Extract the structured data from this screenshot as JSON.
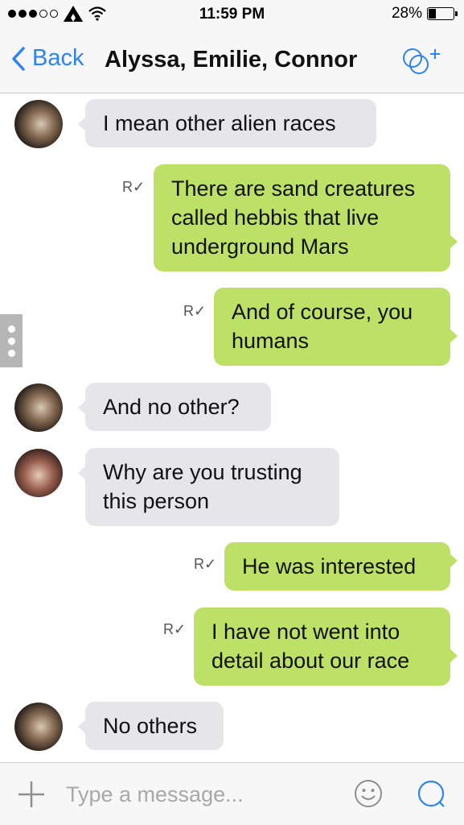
{
  "status": {
    "time": "11:59 PM",
    "battery": "28%",
    "battery_level": 0.28
  },
  "nav": {
    "back_label": "Back",
    "title": "Alyssa, Emilie, Connor",
    "accent_color": "#2b83f6"
  },
  "messages": [
    {
      "direction": "in",
      "text": "I mean other alien races"
    },
    {
      "direction": "out",
      "text": [
        "There are sand creatures",
        "called hebbis that live",
        "underground Mars"
      ],
      "receipt": "R"
    },
    {
      "direction": "out",
      "text": [
        "And of course, you",
        "humans"
      ],
      "receipt": "R"
    },
    {
      "direction": "in",
      "text": "And no other?"
    },
    {
      "direction": "in",
      "text": [
        "Why are you trusting",
        "this person"
      ]
    },
    {
      "direction": "out",
      "text": "He was interested",
      "receipt": "R"
    },
    {
      "direction": "out",
      "text": [
        "I have not went into",
        "detail about our race"
      ],
      "receipt": "R"
    },
    {
      "direction": "in",
      "text": "No others"
    }
  ],
  "m": {
    "m1": "I mean other alien races",
    "m2a": "There are sand creatures",
    "m2b": "called hebbis that live",
    "m2c": "underground Mars",
    "m3a": "And of course, you",
    "m3b": "humans",
    "m4": "And no other?",
    "m5a": "Why are you trusting",
    "m5b": "this person",
    "m6": "He was interested",
    "m7a": "I have not went into",
    "m7b": "detail about our race",
    "m8": "No others",
    "receipt": "R"
  },
  "input": {
    "placeholder": "Type a message..."
  },
  "colors": {
    "incoming_bubble": "#e5e5ea",
    "outgoing_bubble": "#bde067"
  }
}
